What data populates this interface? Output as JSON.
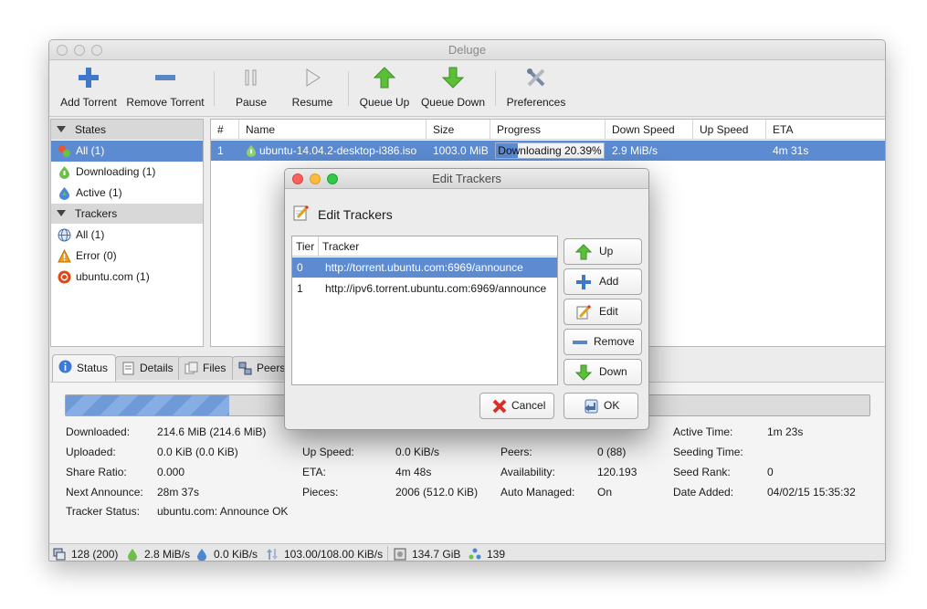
{
  "window": {
    "title": "Deluge"
  },
  "toolbar": {
    "add_torrent": "Add Torrent",
    "remove_torrent": "Remove Torrent",
    "pause": "Pause",
    "resume": "Resume",
    "queue_up": "Queue Up",
    "queue_down": "Queue Down",
    "preferences": "Preferences"
  },
  "sidebar": {
    "states_header": "States",
    "states": [
      {
        "label": "All (1)",
        "icon": "all-states-icon",
        "selected": true
      },
      {
        "label": "Downloading (1)",
        "icon": "downloading-icon"
      },
      {
        "label": "Active (1)",
        "icon": "active-icon"
      }
    ],
    "trackers_header": "Trackers",
    "trackers": [
      {
        "label": "All (1)",
        "icon": "globe-icon"
      },
      {
        "label": "Error (0)",
        "icon": "warning-icon"
      },
      {
        "label": "ubuntu.com (1)",
        "icon": "ubuntu-icon"
      }
    ]
  },
  "torrent_list": {
    "columns": [
      "#",
      "Name",
      "Size",
      "Progress",
      "Down Speed",
      "Up Speed",
      "ETA"
    ],
    "rows": [
      {
        "num": "1",
        "name": "ubuntu-14.04.2-desktop-i386.iso",
        "size": "1003.0 MiB",
        "progress_text": "Downloading 20.39%",
        "progress": 0.2039,
        "down_speed": "2.9 MiB/s",
        "up_speed": "",
        "eta": "4m 31s"
      }
    ]
  },
  "tabs": [
    "Status",
    "Details",
    "Files",
    "Peers"
  ],
  "status": {
    "progress": 0.2039,
    "downloaded_label": "Downloaded:",
    "downloaded": "214.6 MiB (214.6 MiB)",
    "uploaded_label": "Uploaded:",
    "uploaded": "0.0 KiB (0.0 KiB)",
    "share_ratio_label": "Share Ratio:",
    "share_ratio": "0.000",
    "next_announce_label": "Next Announce:",
    "next_announce": "28m 37s",
    "tracker_status_label": "Tracker Status:",
    "tracker_status": "ubuntu.com: Announce OK",
    "up_speed_label": "Up Speed:",
    "up_speed": "0.0 KiB/s",
    "eta_label": "ETA:",
    "eta": "4m 48s",
    "pieces_label": "Pieces:",
    "pieces": "2006 (512.0 KiB)",
    "peers_label": "Peers:",
    "peers": "0 (88)",
    "availability_label": "Availability:",
    "availability": "120.193",
    "auto_managed_label": "Auto Managed:",
    "auto_managed": "On",
    "active_time_label": "Active Time:",
    "active_time": "1m 23s",
    "seeding_time_label": "Seeding Time:",
    "seeding_time": "",
    "seed_rank_label": "Seed Rank:",
    "seed_rank": "0",
    "date_added_label": "Date Added:",
    "date_added": "04/02/15 15:35:32"
  },
  "statusbar": {
    "connections": "128 (200)",
    "down_speed": "2.8 MiB/s",
    "up_speed": "0.0 KiB/s",
    "protocol": "103.00/108.00 KiB/s",
    "free_space": "134.7 GiB",
    "dht_nodes": "139"
  },
  "dialog": {
    "title": "Edit Trackers",
    "heading": "Edit Trackers",
    "columns": [
      "Tier",
      "Tracker"
    ],
    "trackers": [
      {
        "tier": "0",
        "url": "http://torrent.ubuntu.com:6969/announce",
        "selected": true
      },
      {
        "tier": "1",
        "url": "http://ipv6.torrent.ubuntu.com:6969/announce"
      }
    ],
    "buttons": {
      "up": "Up",
      "add": "Add",
      "edit": "Edit",
      "remove": "Remove",
      "down": "Down"
    },
    "cancel": "Cancel",
    "ok": "OK"
  },
  "colors": {
    "selection": "#5c8bd2",
    "close": "#fc605c",
    "minimize": "#fdbc40",
    "zoom": "#34c84a"
  }
}
